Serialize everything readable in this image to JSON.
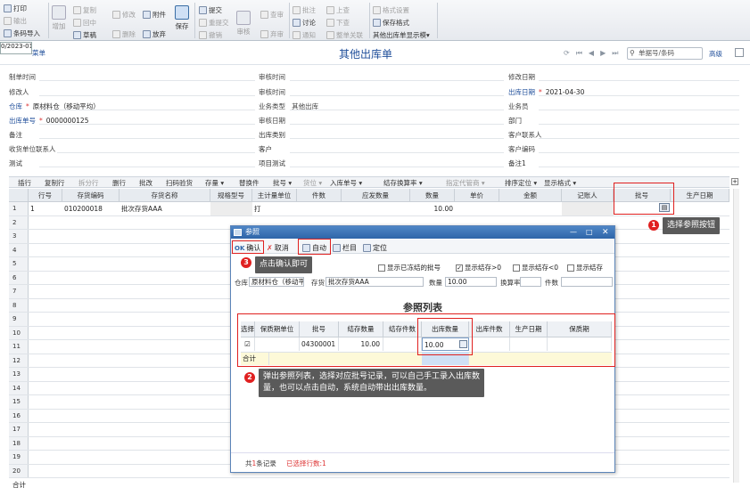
{
  "ribbon": {
    "print": "打印",
    "export": "输出",
    "barcode_import": "条码导入",
    "add": "增加",
    "copy": "复制",
    "recover": "回中",
    "draft": "草稿",
    "modify": "修改",
    "attachment": "附件",
    "delete": "删除",
    "discard": "放弃",
    "save": "保存",
    "submit": "提交",
    "resubmit": "重提交",
    "revoke": "撤销",
    "audit": "审核",
    "view_audit": "查审",
    "deny": "弃审",
    "annotate": "批注",
    "discuss": "讨论",
    "notify": "通知",
    "prev": "上查",
    "next": "下查",
    "doc_link": "整单关联",
    "format_settings": "格式设置",
    "save_format": "保存格式",
    "display_template": "其他出库单显示模▾"
  },
  "date_box": "0/2023-01",
  "list_btn": "菜单",
  "page_title": "其他出库单",
  "search_placeholder": "单据号/条码",
  "search_btn": "高级",
  "header": {
    "make_time": "制单时间",
    "audit_time": "审核时间",
    "modify_date": "修改日期",
    "modifier": "修改人",
    "auditor": "审核时间",
    "out_date_label": "出库日期",
    "out_date": "2021-04-30",
    "warehouse_label": "仓库",
    "warehouse": "原材料仓（移动平均）",
    "biz_type_label": "业务类型",
    "biz_type": "其他出库",
    "salesman": "业务员",
    "out_no_label": "出库单号",
    "out_no": "0000000125",
    "audit_date": "审核日期",
    "dept": "部门",
    "remark": "备注",
    "out_category": "出库类别",
    "customer_contact": "客户联系人",
    "receiver_contact": "收货单位联系人",
    "customer": "客户",
    "customer_code": "客户编码",
    "test": "测试",
    "project_test": "项目测试",
    "remark1": "备注1"
  },
  "toolbar2": [
    "插行",
    "复制行",
    "拆分行",
    "删行",
    "批改",
    "扫码验货",
    "存量 ▾",
    "替换件",
    "批号 ▾",
    "货位 ▾",
    "入库单号 ▾",
    "结存换算率 ▾",
    "指定代管商 ▾",
    "排序定位 ▾",
    "显示格式 ▾"
  ],
  "grid": {
    "headers": [
      "行号",
      "存货编码",
      "存货名称",
      "规格型号",
      "主计量单位",
      "件数",
      "应发数量",
      "数量",
      "单价",
      "金额",
      "记账人",
      "批号",
      "生产日期"
    ],
    "row1": {
      "no": "1",
      "seq": "1",
      "code": "010200018",
      "name": "批次存货AAA",
      "unit": "打",
      "qty": "10.00"
    },
    "row_numbers": [
      "1",
      "2",
      "3",
      "4",
      "5",
      "6",
      "7",
      "8",
      "9",
      "10",
      "11",
      "12",
      "13",
      "14",
      "15",
      "16",
      "17",
      "18",
      "19",
      "20"
    ],
    "total_label": "合计"
  },
  "dialog": {
    "title": "参照",
    "confirm": "确认",
    "cancel": "取消",
    "auto": "自动",
    "columns": "栏目",
    "locate": "定位",
    "opt_no_batch": "显示已冻结的批号",
    "opt_stock_gt0": "显示结存>0",
    "opt_stock_lt0": "显示结存<0",
    "opt_show_stock": "显示结存",
    "warehouse_label": "仓库",
    "warehouse": "原材料仓（移动平均）",
    "item_label": "存货",
    "item": "批次存货AAA",
    "qty_label": "数量",
    "qty": "10.00",
    "rate_label": "换算率",
    "pcs_label": "件数",
    "list_title": "参照列表",
    "headers": [
      "选择",
      "保质期单位",
      "批号",
      "结存数量",
      "结存件数",
      "出库数量",
      "出库件数",
      "生产日期",
      "保质期"
    ],
    "row": {
      "batch": "04300001",
      "stock": "10.00",
      "out_qty": "10.00"
    },
    "total_label": "合计",
    "footer_count_a": "共",
    "footer_count_num": "1",
    "footer_count_b": "条记录",
    "footer_selected": "已选择行数:1"
  },
  "callouts": {
    "c1_num": "1",
    "c1": "选择参照按钮",
    "c2_num": "2",
    "c2": "弹出参照列表，选择对应批号记录，可以自己手工录入出库数量，也可以点击自动，系统自动带出出库数量。",
    "c3_num": "3",
    "c3": "点击确认即可"
  }
}
